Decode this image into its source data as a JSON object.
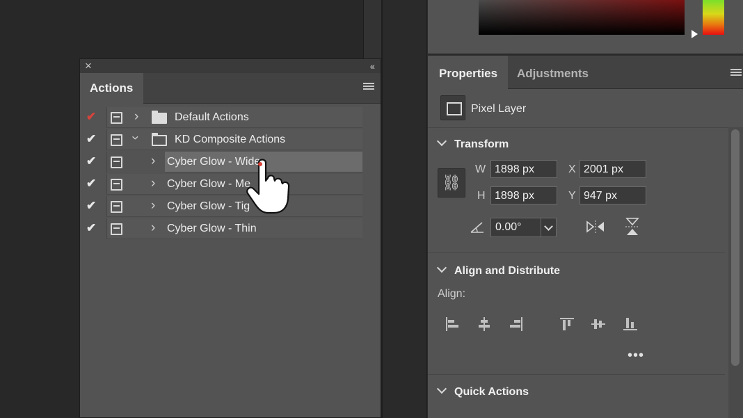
{
  "actions_panel": {
    "close_icon": "×",
    "collapse_icon": "‹‹",
    "tab_label": "Actions",
    "rows": [
      {
        "label": "Default Actions",
        "check_color": "red",
        "expanded": false,
        "type": "set"
      },
      {
        "label": "KD Composite Actions",
        "check_color": "white",
        "expanded": true,
        "type": "set"
      },
      {
        "label": "Cyber Glow - Wide",
        "check_color": "white",
        "expanded": false,
        "type": "action",
        "selected": true
      },
      {
        "label": "Cyber Glow - Me",
        "check_color": "white",
        "expanded": false,
        "type": "action"
      },
      {
        "label": "Cyber Glow - Tig",
        "check_color": "white",
        "expanded": false,
        "type": "action"
      },
      {
        "label": "Cyber Glow - Thin",
        "check_color": "white",
        "expanded": false,
        "type": "action"
      }
    ]
  },
  "properties_panel": {
    "tabs": [
      "Properties",
      "Adjustments"
    ],
    "layer_type": "Pixel Layer",
    "transform": {
      "title": "Transform",
      "w_label": "W",
      "w_value": "1898 px",
      "x_label": "X",
      "x_value": "2001 px",
      "h_label": "H",
      "h_value": "1898 px",
      "y_label": "Y",
      "y_value": "947 px",
      "angle_value": "0.00°"
    },
    "align": {
      "title": "Align and Distribute",
      "align_label": "Align:",
      "more_icon": "•••"
    },
    "quick_actions": {
      "title": "Quick Actions"
    }
  },
  "colors": {
    "panel": "#535353",
    "check_red": "#d8433a",
    "selected_row": "#6c6c6c"
  }
}
